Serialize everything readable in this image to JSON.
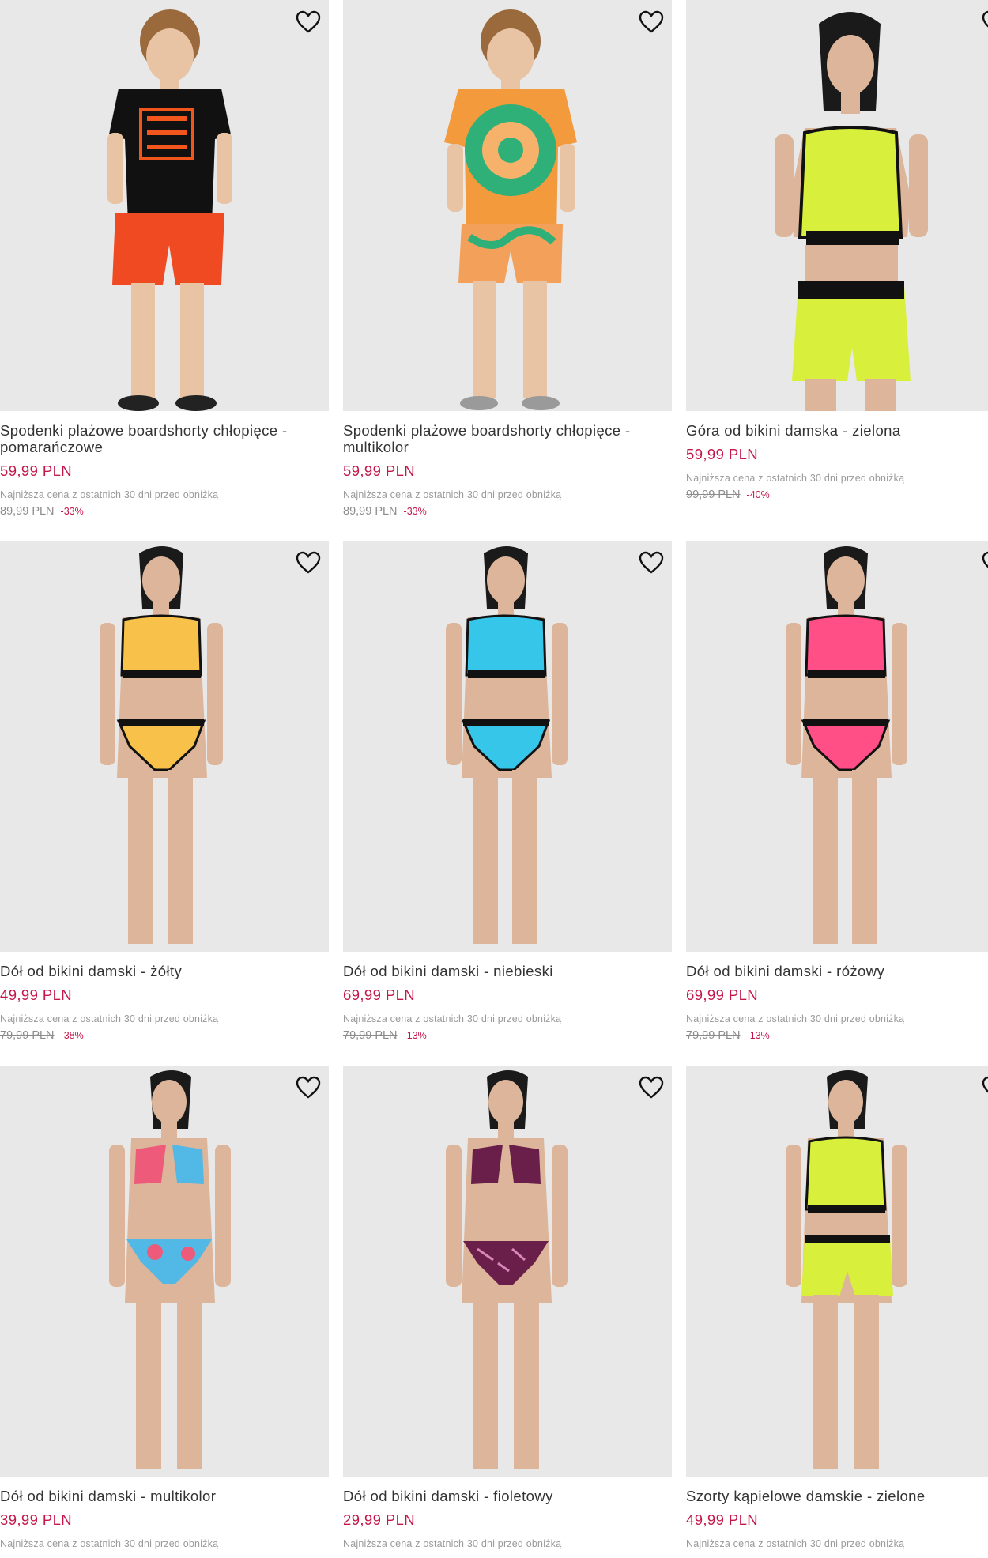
{
  "colors": {
    "accent": "#c3174a",
    "photo_bg": "#e8e8e8"
  },
  "products": [
    {
      "name": "Spodenki plażowe boardshorty chłopięce - pomarańczowe",
      "price": "59,99 PLN",
      "lowest_note": "Najniższa cena z ostatnich 30 dni przed obniżką",
      "old_price": "89,99 PLN",
      "discount": "-33%",
      "icon": "heart-icon"
    },
    {
      "name": "Spodenki plażowe boardshorty chłopięce - multikolor",
      "price": "59,99 PLN",
      "lowest_note": "Najniższa cena z ostatnich 30 dni przed obniżką",
      "old_price": "89,99 PLN",
      "discount": "-33%",
      "icon": "heart-icon"
    },
    {
      "name": "Góra od bikini damska - zielona",
      "price": "59,99 PLN",
      "lowest_note": "Najniższa cena z ostatnich 30 dni przed obniżką",
      "old_price": "99,99 PLN",
      "discount": "-40%",
      "icon": "heart-icon"
    },
    {
      "name": "Dół od bikini damski - żółty",
      "price": "49,99 PLN",
      "lowest_note": "Najniższa cena z ostatnich 30 dni przed obniżką",
      "old_price": "79,99 PLN",
      "discount": "-38%",
      "icon": "heart-icon"
    },
    {
      "name": "Dół od bikini damski - niebieski",
      "price": "69,99 PLN",
      "lowest_note": "Najniższa cena z ostatnich 30 dni przed obniżką",
      "old_price": "79,99 PLN",
      "discount": "-13%",
      "icon": "heart-icon"
    },
    {
      "name": "Dół od bikini damski - różowy",
      "price": "69,99 PLN",
      "lowest_note": "Najniższa cena z ostatnich 30 dni przed obniżką",
      "old_price": "79,99 PLN",
      "discount": "-13%",
      "icon": "heart-icon"
    },
    {
      "name": "Dół od bikini damski - multikolor",
      "price": "39,99 PLN",
      "lowest_note": "Najniższa cena z ostatnich 30 dni przed obniżką",
      "icon": "heart-icon"
    },
    {
      "name": "Dół od bikini damski - fioletowy",
      "price": "29,99 PLN",
      "lowest_note": "Najniższa cena z ostatnich 30 dni przed obniżką",
      "icon": "heart-icon"
    },
    {
      "name": "Szorty kąpielowe damskie - zielone",
      "price": "49,99 PLN",
      "lowest_note": "Najniższa cena z ostatnich 30 dni przed obniżką",
      "icon": "heart-icon"
    }
  ]
}
